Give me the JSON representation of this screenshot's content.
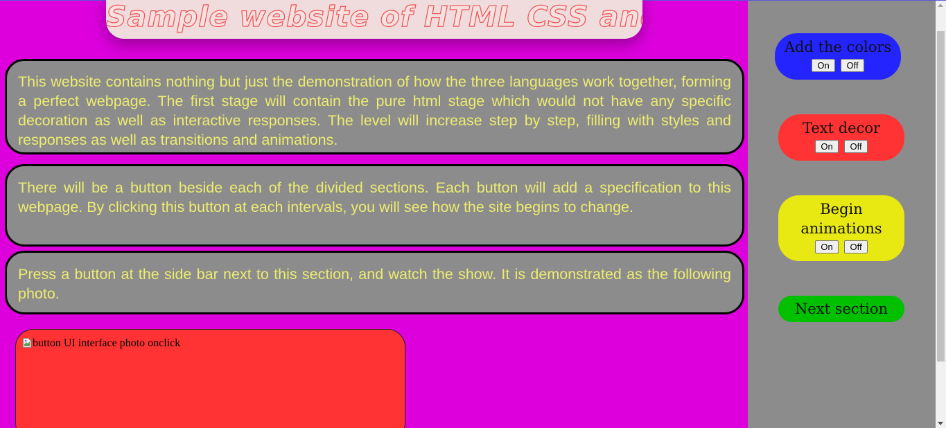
{
  "header": {
    "title": "Sample website of HTML CSS and JS"
  },
  "sections": [
    {
      "text": "This website contains nothing but just the demonstration of how the three languages work together, forming a perfect webpage. The first stage will contain the pure html stage which would not have any specific decoration as well as interactive responses. The level will increase step by step, filling with styles and responses as well as transitions and animations."
    },
    {
      "text": "There will be a button beside each of the divided sections. Each button will add a specification to this webpage. By clicking this button at each intervals, you will see how the site begins to change."
    },
    {
      "text": "Press a button at the side bar next to this section, and watch the show. It is demonstrated as the following photo."
    }
  ],
  "photo": {
    "alt": "button UI interface photo onclick",
    "icon": "broken-image-icon"
  },
  "sidebar": {
    "cards": [
      {
        "label": "Add the colors",
        "on_label": "On",
        "off_label": "Off",
        "color": "#2424ff"
      },
      {
        "label": "Text decor",
        "on_label": "On",
        "off_label": "Off",
        "color": "#ff3333"
      },
      {
        "label": "Begin animations",
        "on_label": "On",
        "off_label": "Off",
        "color": "#e8e812"
      }
    ],
    "next": {
      "label": "Next section",
      "color": "#00c000"
    }
  },
  "colors": {
    "page_background": "#dd00dd",
    "section_background": "#8c8c8c",
    "section_text": "#ecec70",
    "header_background": "#f0dcdc",
    "header_stroke": "#f05050"
  }
}
